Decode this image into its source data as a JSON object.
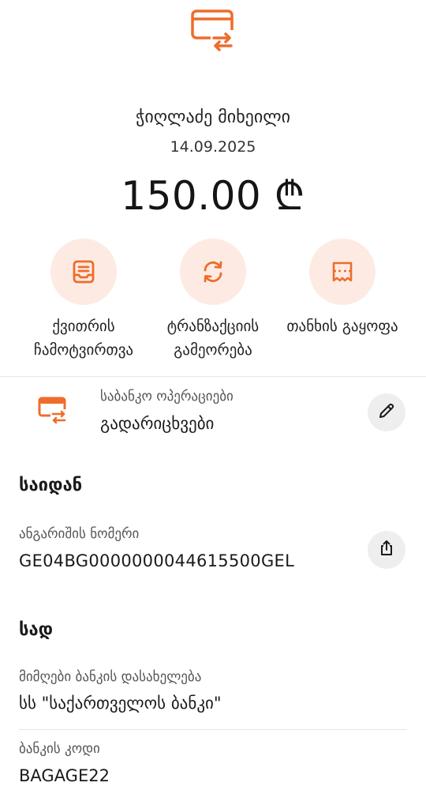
{
  "header": {
    "icon": "card-transfer-icon",
    "recipient_name": "ჭიღლაძე მიხეილი",
    "date": "14.09.2025",
    "amount": "150.00 ₾"
  },
  "actions": [
    {
      "icon": "receipt-download-icon",
      "label": "ქვითრის ჩამოტვირთვა"
    },
    {
      "icon": "repeat-icon",
      "label": "ტრანზაქციის გამეორება"
    },
    {
      "icon": "split-bill-icon",
      "label": "თანხის გაყოფა"
    }
  ],
  "category": {
    "icon": "card-transfer-icon",
    "caption": "საბანკო ოპერაციები",
    "value": "გადარიცხვები",
    "edit_icon": "pencil-icon"
  },
  "from": {
    "title": "საიდან",
    "account_caption": "ანგარიშის ნომერი",
    "account_number": "GE04BG0000000044615500GEL",
    "share_icon": "share-icon"
  },
  "to": {
    "title": "სად",
    "bank_name_caption": "მიმღები ბანკის დასახელება",
    "bank_name": "სს \"საქართველოს ბანკი\"",
    "bank_code_caption": "ბანკის კოდი",
    "bank_code": "BAGAGE22"
  },
  "colors": {
    "accent": "#ef6c2b",
    "accent_bg": "#fdebe3",
    "button_bg": "#eeeeee"
  }
}
